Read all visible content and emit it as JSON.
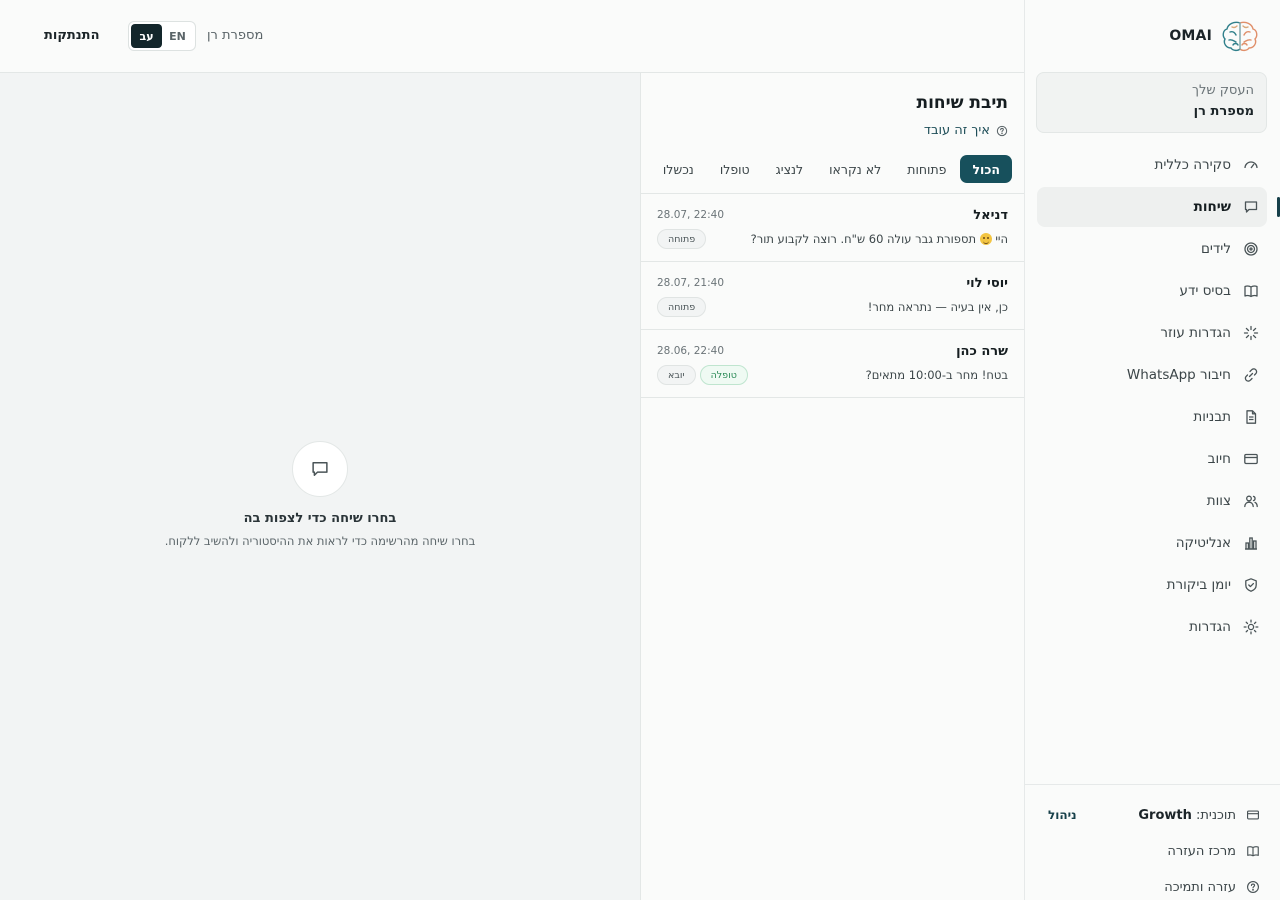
{
  "brand": {
    "name": "OMAI",
    "logo_icon": "brain-icon"
  },
  "business": {
    "label": "העסק שלך",
    "name": "מספרת רן"
  },
  "nav": {
    "items": [
      {
        "label": "סקירה כללית",
        "icon": "gauge-icon"
      },
      {
        "label": "שיחות",
        "icon": "chat-icon",
        "active": true
      },
      {
        "label": "לידים",
        "icon": "target-icon"
      },
      {
        "label": "בסיס ידע",
        "icon": "book-icon"
      },
      {
        "label": "הגדרות עוזר",
        "icon": "sparkle-icon"
      },
      {
        "label": "חיבור WhatsApp",
        "icon": "link-icon"
      },
      {
        "label": "תבניות",
        "icon": "document-icon"
      },
      {
        "label": "חיוב",
        "icon": "credit-card-icon"
      },
      {
        "label": "צוות",
        "icon": "users-icon"
      },
      {
        "label": "אנליטיקה",
        "icon": "bar-chart-icon"
      },
      {
        "label": "יומן ביקורת",
        "icon": "shield-icon"
      },
      {
        "label": "הגדרות",
        "icon": "gear-icon"
      }
    ]
  },
  "footer": {
    "plan_prefix": "תוכנית:",
    "plan_name": "Growth",
    "manage_label": "ניהול",
    "help_center": "מרכז העזרה",
    "support": "עזרה ותמיכה"
  },
  "topbar": {
    "logout": "התנתקות",
    "lang_en": "EN",
    "lang_he": "עב",
    "business_name": "מספרת רן"
  },
  "inbox": {
    "title": "תיבת שיחות",
    "how_it_works": "איך זה עובד",
    "filters": [
      "הכול",
      "פתוחות",
      "לא נקראו",
      "לנציג",
      "טופלו",
      "נכשלו"
    ],
    "active_filter": 0,
    "conversations": [
      {
        "name": "דניאל",
        "time": "28.07, 22:40",
        "preview_before": "היי",
        "preview_after": "תספורת גבר עולה 60 ש\"ח. רוצה לקבוע תור?",
        "badges": [
          {
            "label": "פתוחה",
            "style": "gray"
          }
        ]
      },
      {
        "name": "יוסי לוי",
        "time": "28.07, 21:40",
        "preview": "כן, אין בעיה — נתראה מחר!",
        "badges": [
          {
            "label": "פתוחה",
            "style": "gray"
          }
        ]
      },
      {
        "name": "שרה כהן",
        "time": "28.06, 22:40",
        "preview": "בטח! מחר ב-10:00 מתאים?",
        "badges": [
          {
            "label": "טופלה",
            "style": "green"
          },
          {
            "label": "יובא",
            "style": "gray"
          }
        ]
      }
    ]
  },
  "empty_state": {
    "icon": "chat-icon",
    "title": "בחרו שיחה כדי לצפות בה",
    "subtitle": "בחרו שיחה מהרשימה כדי לראות את ההיסטוריה ולהשיב ללקוח."
  },
  "colors": {
    "accent": "#17505c",
    "accent_dark": "#13262b",
    "badge_green": "#2a8a56",
    "sidebar_bg": "#fafbfa",
    "page_bg": "#f2f4f4"
  }
}
